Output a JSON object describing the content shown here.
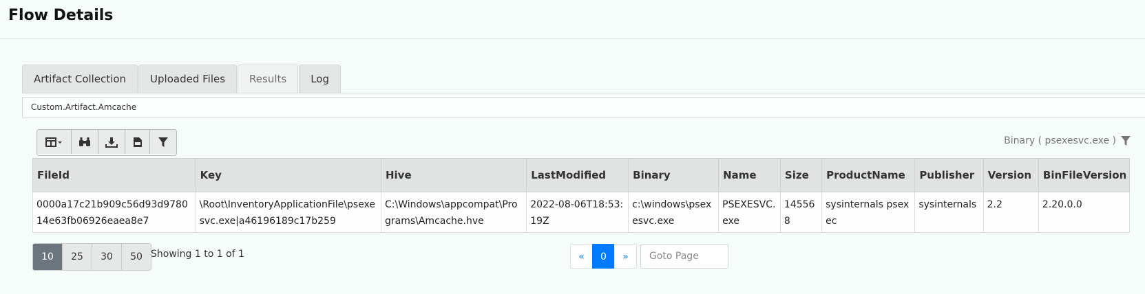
{
  "header": {
    "title": "Flow Details"
  },
  "tabs": [
    {
      "label": "Artifact Collection",
      "active": false
    },
    {
      "label": "Uploaded Files",
      "active": false
    },
    {
      "label": "Results",
      "active": true
    },
    {
      "label": "Log",
      "active": false
    }
  ],
  "artifact_selector": {
    "value": "Custom.Artifact.Amcache"
  },
  "toolbar": {
    "buttons": [
      {
        "icon": "columns-icon"
      },
      {
        "icon": "binoculars-icon"
      },
      {
        "icon": "download-icon"
      },
      {
        "icon": "csv-file-icon"
      },
      {
        "icon": "filter-icon"
      }
    ]
  },
  "filter_status": {
    "text": "Binary ( psexesvc.exe )",
    "icon": "filter-icon"
  },
  "table": {
    "columns": [
      "FileId",
      "Key",
      "Hive",
      "LastModified",
      "Binary",
      "Name",
      "Size",
      "ProductName",
      "Publisher",
      "Version",
      "BinFileVersion"
    ],
    "rows": [
      [
        "0000a17c21b909c56d93d978014e63fb06926eaea8e7",
        "\\Root\\InventoryApplicationFile\\psexesvc.exe|a46196189c17b259",
        "C:\\Windows\\appcompat\\Programs\\Amcache.hve",
        "2022-08-06T18:53:19Z",
        "c:\\windows\\psexesvc.exe",
        "PSEXESVC.exe",
        "145568",
        "sysinternals psexec",
        "sysinternals",
        "2.2",
        "2.20.0.0"
      ]
    ]
  },
  "pagination": {
    "page_sizes": [
      "10",
      "25",
      "30",
      "50"
    ],
    "selected_page_size": "10",
    "showing_text": "Showing 1 to 1 of 1",
    "prev_label": "«",
    "current_page": "0",
    "next_label": "»",
    "goto_placeholder": "Goto Page"
  },
  "colors": {
    "accent": "#007bff",
    "active_page_size": "#6c757d",
    "background": "#f6fcf9"
  }
}
